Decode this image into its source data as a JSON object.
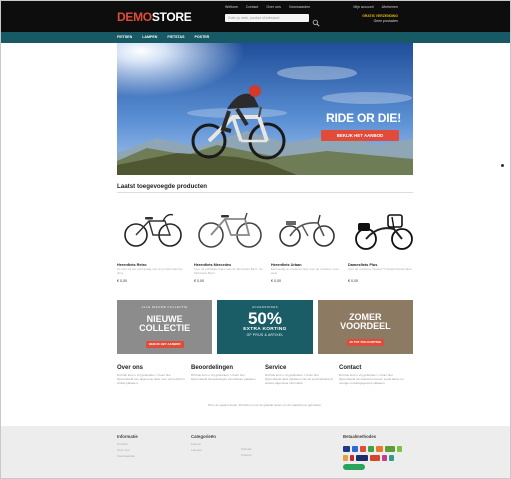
{
  "header": {
    "logo_part1": "DEMO",
    "logo_part2": "STORE",
    "top_links": [
      "Welkom",
      "Contact",
      "Over ons",
      "Voorwaarden"
    ],
    "search_placeholder": "Zoek op merk, product of trefwoord",
    "account_links": [
      "Mijn account",
      "Afrekenen"
    ],
    "shipping_line1": "GRATIS VERZENDING",
    "shipping_line2": "Geen producten"
  },
  "nav": {
    "items": [
      "FIETSEN",
      "LAMPEN",
      "FIETSTAS",
      "POSTER"
    ]
  },
  "hero": {
    "title": "RIDE OR DIE!",
    "button": "BEKIJK HET AANBOD"
  },
  "products_section": {
    "title": "Laatst toegevoegde producten",
    "items": [
      {
        "name": "Herenfiets Retro",
        "desc": "Zo zien wij het echt graag met onze fiets.Heel fijn ding.",
        "price": "€ 0,00"
      },
      {
        "name": "Herenfiets Mercedes",
        "desc": "Voor de echtelijke ritjes naar de Mercedes Benz. Zo Mercedes Benz.",
        "price": "€ 0,00"
      },
      {
        "name": "Herenfiets Urban",
        "desc": "Eenvoudig en moderne fiets voor de moderne man. Heel",
        "price": "€ 0,00"
      },
      {
        "name": "Damesfiets Plus",
        "desc": "Voor de moderne moeder? Inclusief kinderzitjes.",
        "price": "€ 0,00"
      }
    ]
  },
  "banners": {
    "b1": {
      "small": "ALLE NIEUWE COLLECTIE",
      "line1": "NIEUWE",
      "line2": "COLLECTIE",
      "pill": "BEKIJK HET AANBOD"
    },
    "b2": {
      "small": "ACCESSOIRES",
      "pct": "50%",
      "sub": "EXTRA KORTING",
      "sub2": "OP PRIJS & ARTIKEL"
    },
    "b3": {
      "line1": "ZOMER",
      "line2": "VOORDEEL",
      "pill": "30 TOT 50% KORTING"
    }
  },
  "info": [
    {
      "title": "Over ons",
      "text": "Dit blok kunt u vrij gebruiken. U kunt hier bijvoorbeeld een algemene tekst over uw bedrijf en winkel plaatsen."
    },
    {
      "title": "Beoordelingen",
      "text": "Dit blok kunt u vrij gebruiken. U kunt hier bijvoorbeeld beoordelingen van klanten plaatsen."
    },
    {
      "title": "Service",
      "text": "Dit blok kunt u vrij gebruiken. U kunt hier bijvoorbeeld tekst plaatsen met uw servicebeleid of andere algemene informatie."
    },
    {
      "title": "Contact",
      "text": "Dit blok kunt u vrij gebruiken. U kunt hier bijvoorbeeld uw telefoonnummer, email adres en overige contactgegevens plaatsen."
    }
  ],
  "footnote": "Dit is de pagina footer. Dit blok is voor de globale footer om de webshop te gebruiken.",
  "footer": {
    "col1": {
      "title": "Informatie",
      "links": [
        "Contact",
        "Over ons",
        "Voorwaarden"
      ]
    },
    "col2": {
      "title": "Categorieën",
      "links": [
        "Fietsen",
        "Lampen"
      ],
      "links2": [
        "Fietstas",
        "Posters"
      ]
    },
    "col3": {
      "title": "Betaalmethodes"
    }
  },
  "colors": {
    "accent_red": "#e14b3a",
    "nav_teal": "#175a66",
    "topbar_black": "#0d0d0d"
  }
}
